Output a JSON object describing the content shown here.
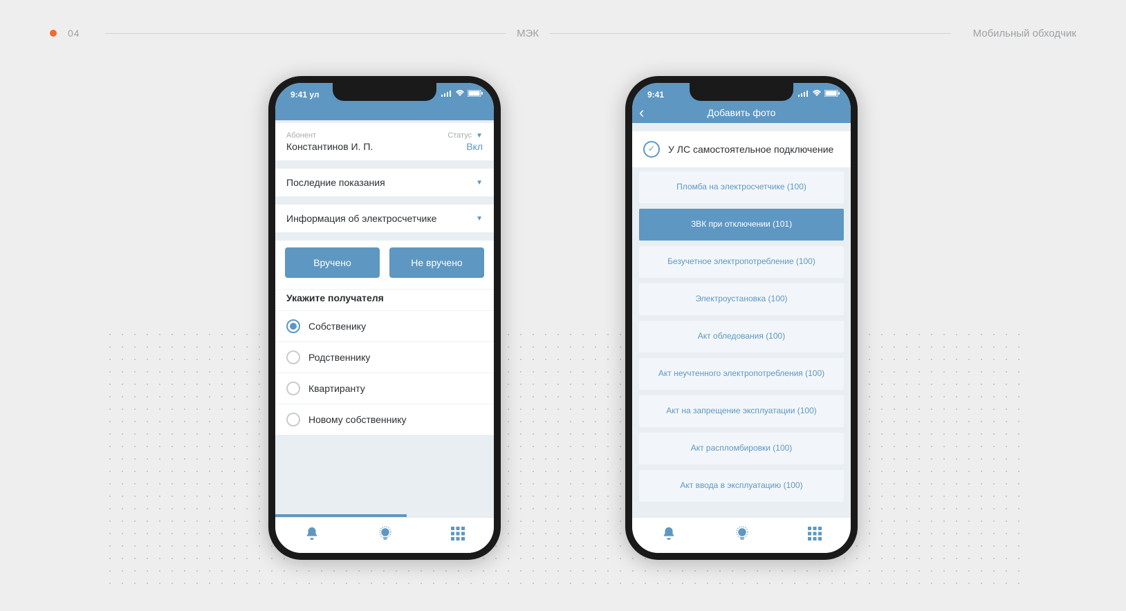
{
  "page": {
    "number": "04",
    "brand": "МЭК",
    "tagline": "Мобильный обходчик"
  },
  "common": {
    "time": "9:41"
  },
  "screen1": {
    "top_prefix": "ул",
    "subscriber_label": "Абонент",
    "subscriber_value": "Константинов И. П.",
    "status_label": "Статус",
    "status_value": "Вкл",
    "section_readings": "Последние показания",
    "section_meter": "Информация об электросчетчике",
    "btn_handed": "Вручено",
    "btn_not_handed": "Не вручено",
    "recipient_title": "Укажите получателя",
    "radios": [
      {
        "label": "Собственику",
        "selected": true
      },
      {
        "label": "Родственнику",
        "selected": false
      },
      {
        "label": "Квартиранту",
        "selected": false
      },
      {
        "label": "Новому собственнику",
        "selected": false
      }
    ]
  },
  "screen2": {
    "title": "Добавить фото",
    "check_text": "У ЛС самостоятельное подключение",
    "options": [
      {
        "label": "Пломба на электросчетчике (100)",
        "selected": false
      },
      {
        "label": "ЗВК при отключении (101)",
        "selected": true
      },
      {
        "label": "Безучетное электропотребление (100)",
        "selected": false
      },
      {
        "label": "Электроустановка (100)",
        "selected": false
      },
      {
        "label": "Акт обледования (100)",
        "selected": false
      },
      {
        "label": "Акт неучтенного электропотребления (100)",
        "selected": false
      },
      {
        "label": "Акт на запрещение эксплуатации (100)",
        "selected": false
      },
      {
        "label": "Акт распломбировки (100)",
        "selected": false
      },
      {
        "label": "Акт ввода в эксплуатацию (100)",
        "selected": false
      }
    ]
  }
}
